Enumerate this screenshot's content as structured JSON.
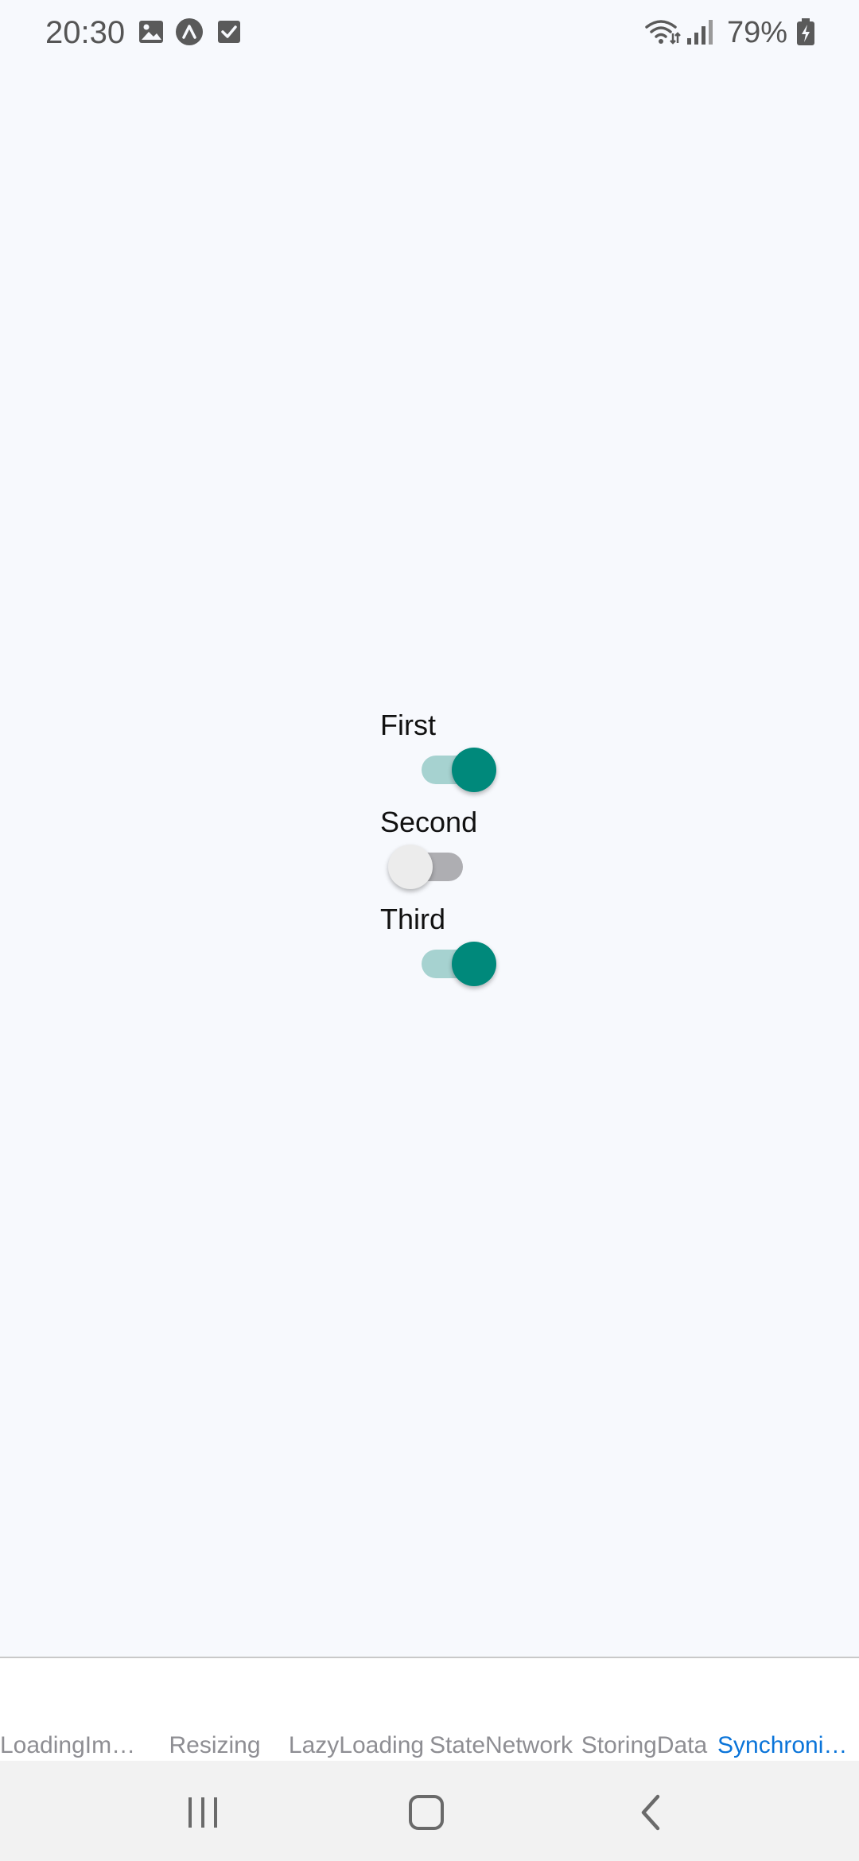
{
  "status_bar": {
    "time": "20:30",
    "battery": "79%",
    "icons": [
      "image-icon",
      "app-circle-icon",
      "checkbox-icon",
      "wifi-icon",
      "signal-icon",
      "battery-icon"
    ]
  },
  "switches": [
    {
      "label": "First",
      "on": true
    },
    {
      "label": "Second",
      "on": false
    },
    {
      "label": "Third",
      "on": true
    }
  ],
  "tabs": [
    {
      "label": "LoadingIma...",
      "active": false
    },
    {
      "label": "Resizing",
      "active": false
    },
    {
      "label": "LazyLoading",
      "active": false
    },
    {
      "label": "StateNetwork",
      "active": false
    },
    {
      "label": "StoringData",
      "active": false
    },
    {
      "label": "Synchronizi...",
      "active": true
    }
  ],
  "colors": {
    "background": "#f7f9fd",
    "switch_on_thumb": "#00897b",
    "switch_on_track": "#a6d2d0",
    "switch_off_thumb": "#ececec",
    "switch_off_track": "#aeaeb2",
    "tab_active": "#0a74d9",
    "tab_inactive": "#8e8e93"
  },
  "nav_bar": {
    "buttons": [
      "recent-apps-icon",
      "home-icon",
      "back-icon"
    ]
  }
}
